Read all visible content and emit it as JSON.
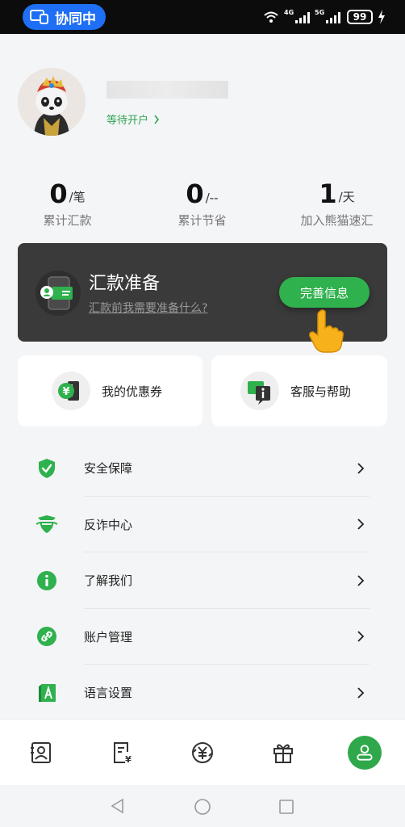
{
  "status_bar": {
    "collab_label": "协同中",
    "network_1": "4G",
    "network_2": "5G",
    "battery": "99"
  },
  "profile": {
    "status_link": "等待开户"
  },
  "stats": [
    {
      "value": "0",
      "unit": "/笔",
      "label": "累计汇款"
    },
    {
      "value": "0",
      "unit": "/--",
      "label": "累计节省"
    },
    {
      "value": "1",
      "unit": "/天",
      "label": "加入熊猫速汇"
    }
  ],
  "prep_card": {
    "title": "汇款准备",
    "subtitle": "汇款前我需要准备什么?",
    "button": "完善信息"
  },
  "quick_actions": [
    {
      "label": "我的优惠券",
      "icon": "coupon-icon"
    },
    {
      "label": "客服与帮助",
      "icon": "customer-service-icon"
    }
  ],
  "menu": [
    {
      "label": "安全保障",
      "icon": "shield-check-icon"
    },
    {
      "label": "反诈中心",
      "icon": "anti-fraud-icon"
    },
    {
      "label": "了解我们",
      "icon": "info-icon"
    },
    {
      "label": "账户管理",
      "icon": "link-icon"
    },
    {
      "label": "语言设置",
      "icon": "language-icon"
    }
  ],
  "bottom_nav": [
    {
      "icon": "contacts-icon",
      "active": false
    },
    {
      "icon": "bill-icon",
      "active": false
    },
    {
      "icon": "remit-icon",
      "active": false
    },
    {
      "icon": "gift-icon",
      "active": false
    },
    {
      "icon": "profile-icon",
      "active": true
    }
  ],
  "colors": {
    "accent": "#2fa84b",
    "collab_pill": "#1e6ff5",
    "dark_card": "#3a3a3a"
  }
}
